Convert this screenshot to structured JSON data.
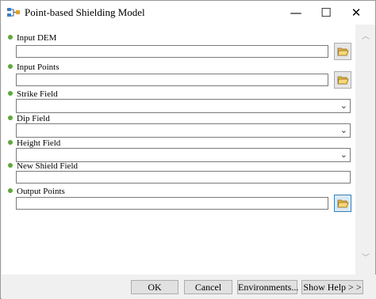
{
  "window": {
    "title": "Point-based Shielding Model",
    "minimize_glyph": "—",
    "maximize_glyph": "☐",
    "close_glyph": "✕"
  },
  "icons": {
    "app": "model-icon",
    "browse": "open-folder-icon",
    "combo": "chevron-down-icon",
    "scroll_up": "scroll-up-arrow",
    "scroll_down": "scroll-down-arrow"
  },
  "colors": {
    "bullet": "#5fa83a",
    "browse_active": "#3c7fb1"
  },
  "params": {
    "input_dem": {
      "label": "Input DEM",
      "value": ""
    },
    "input_points": {
      "label": "Input Points",
      "value": ""
    },
    "strike_field": {
      "label": "Strike Field",
      "value": ""
    },
    "dip_field": {
      "label": "Dip Field",
      "value": ""
    },
    "height_field": {
      "label": "Height Field",
      "value": ""
    },
    "new_shield_field": {
      "label": "New Shield Field",
      "value": ""
    },
    "output_points": {
      "label": "Output Points",
      "value": ""
    }
  },
  "buttons": {
    "ok": "OK",
    "cancel": "Cancel",
    "environments": "Environments...",
    "show_help": "Show Help > >"
  }
}
